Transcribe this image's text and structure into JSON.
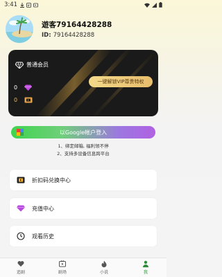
{
  "status_bar": {
    "time": "3:41"
  },
  "profile": {
    "name": "遊客79164428288",
    "uid_label": "ID:",
    "uid_value": "79164428288"
  },
  "vip_card": {
    "level": "普通会员",
    "unlock_button": "一键解锁VIP尊贵特权",
    "diamond_count": "0",
    "ticket_count": "0"
  },
  "login": {
    "google_button": "以Google帐户登入",
    "benefits": [
      "1、绑定邮箱, 福利领不停",
      "2、支持多设备信息跨平台"
    ]
  },
  "menu": [
    {
      "label": "折扣码兑换中心",
      "icon": "ticket-icon"
    },
    {
      "label": "充值中心",
      "icon": "diamond-icon"
    },
    {
      "label": "观看历史",
      "icon": "clock-icon"
    }
  ],
  "tabs": [
    {
      "label": "追剧",
      "icon": "heart-icon",
      "active": false
    },
    {
      "label": "剧场",
      "icon": "theater-icon",
      "active": false
    },
    {
      "label": "小说",
      "icon": "fire-icon",
      "active": false
    },
    {
      "label": "我",
      "icon": "person-icon",
      "active": true
    }
  ],
  "colors": {
    "accent_green": "#2f8f3a",
    "gold": "#e6bd6c",
    "card_bg": "#1a1a1a"
  }
}
